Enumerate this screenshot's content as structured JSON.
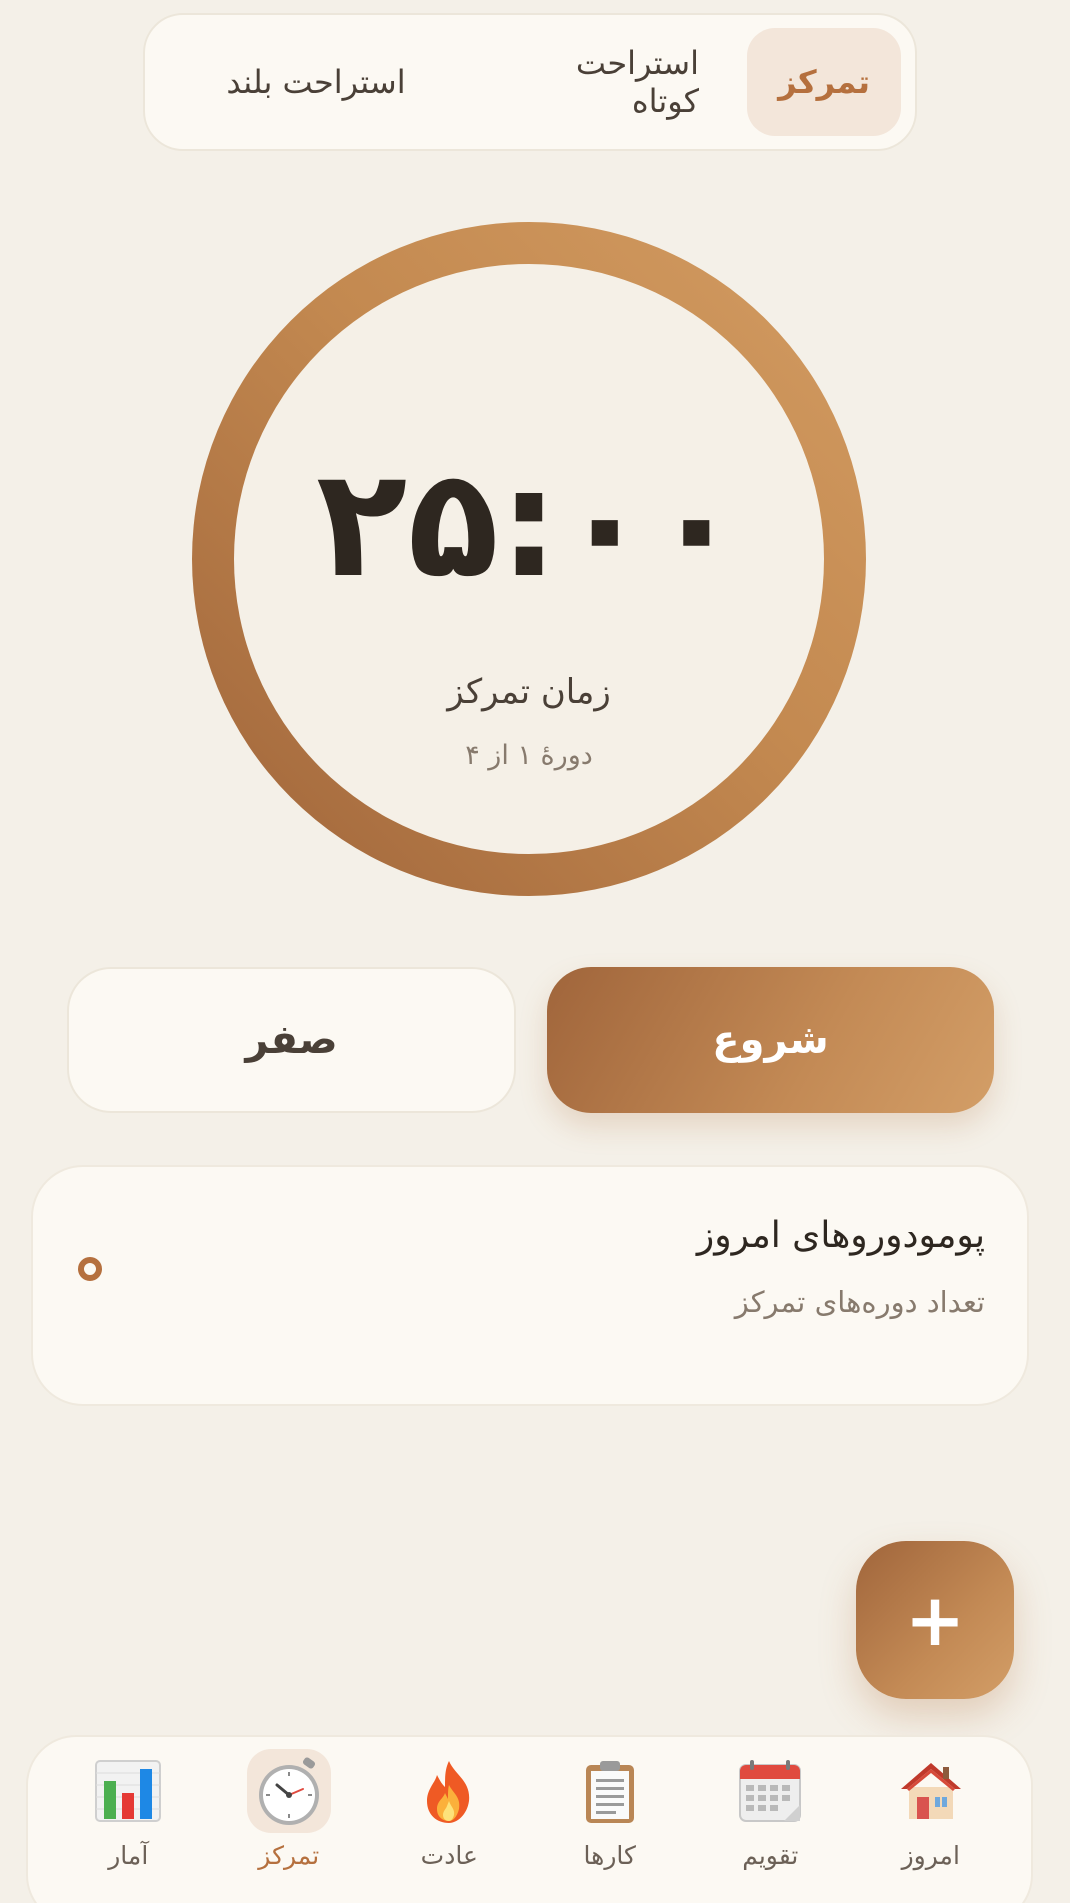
{
  "mode_tabs": {
    "focus": "تمرکز",
    "short_break": "استراحت کوتاه",
    "long_break": "استراحت بلند"
  },
  "timer": {
    "time": "۲۵:۰۰",
    "label": "زمان تمرکز",
    "round": "دورهٔ ۱ از ۴"
  },
  "buttons": {
    "start": "شروع",
    "reset": "صفر"
  },
  "pomodoro_card": {
    "title": "پومودوروهای امروز",
    "subtitle": "تعداد دوره‌های تمرکز"
  },
  "fab": {
    "label": "+"
  },
  "bottom_nav": {
    "items": [
      {
        "label": "امروز",
        "icon": "house-icon"
      },
      {
        "label": "تقویم",
        "icon": "calendar-icon"
      },
      {
        "label": "کارها",
        "icon": "clipboard-icon"
      },
      {
        "label": "عادت",
        "icon": "fire-icon"
      },
      {
        "label": "تمرکز",
        "icon": "stopwatch-icon"
      },
      {
        "label": "آمار",
        "icon": "bar-chart-icon"
      }
    ]
  },
  "colors": {
    "accent": "#b5703e",
    "accent_gradient_start": "#a0653b",
    "accent_gradient_end": "#d39e67",
    "background": "#f4f0e8",
    "surface": "#fcf9f3",
    "active_tab_bg": "#f3e6da"
  }
}
